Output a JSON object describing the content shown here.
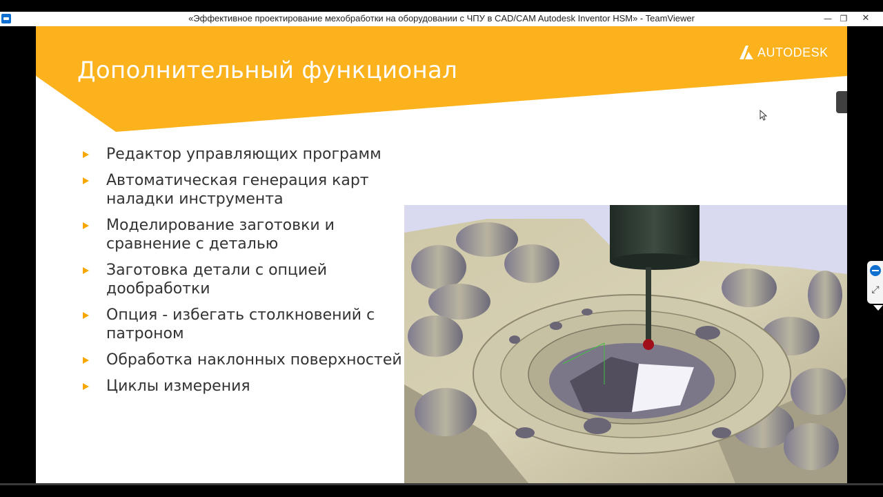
{
  "window": {
    "title": "«Эффективное проектирование мехобработки на оборудовании с ЧПУ в CAD/CAM Autodesk Inventor HSM» - TeamViewer",
    "minimize_label": "—",
    "restore_label": "❐",
    "close_label": "✕"
  },
  "slide": {
    "title": "Дополнительный функционал",
    "logo_text": "AUTODESK",
    "bullets": [
      "Редактор управляющих программ",
      "Автоматическая генерация карт наладки инструмента",
      "Моделирование заготовки и сравнение с деталью",
      "Заготовка детали с опцией дообработки",
      "Опция - избегать столкновений с патроном",
      "Обработка наклонных поверхностей",
      "Циклы измерения"
    ]
  },
  "colors": {
    "accent": "#F6A800",
    "banner": "#FBB21C",
    "text": "#333333",
    "render_bg": "#D9DAF0",
    "teamviewer_blue": "#0E6FD0"
  },
  "icons": {
    "app": "teamviewer-icon",
    "logo": "autodesk-logo-icon",
    "bullet": "triangle-bullet-icon",
    "panel_logo": "teamviewer-panel-icon",
    "panel_expand": "expand-icon"
  }
}
